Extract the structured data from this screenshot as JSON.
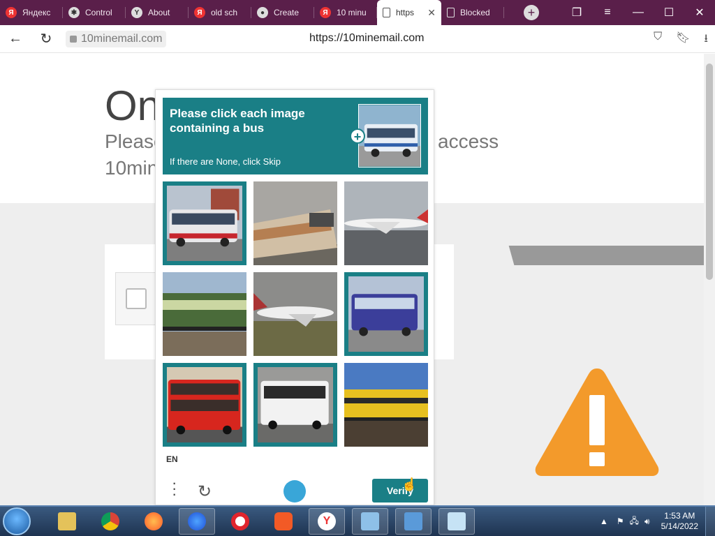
{
  "tabs": [
    {
      "label": "Яндекс",
      "icon": "yandex-icon"
    },
    {
      "label": "Control",
      "icon": "spider-icon"
    },
    {
      "label": "About",
      "icon": "yandex-browser-icon"
    },
    {
      "label": "old sch",
      "icon": "yandex-icon"
    },
    {
      "label": "Create",
      "icon": "github-icon"
    },
    {
      "label": "10 minu",
      "icon": "yandex-icon"
    },
    {
      "label": "https",
      "icon": "document-icon",
      "active": true
    },
    {
      "label": "Blocked",
      "icon": "document-icon"
    }
  ],
  "address": {
    "domain": "10minemail.com",
    "url": "https://10minemail.com"
  },
  "page": {
    "title_partial": "On",
    "sub_left": "Please",
    "sub_right": "access",
    "sub_line2": "10min"
  },
  "captcha": {
    "prompt": "Please click each image containing a bus",
    "hint": "If there are None, click Skip",
    "language": "EN",
    "verify_label": "Verify",
    "tiles": [
      {
        "subject": "bus",
        "selected": true
      },
      {
        "subject": "train",
        "selected": false
      },
      {
        "subject": "airplane",
        "selected": false
      },
      {
        "subject": "train",
        "selected": false
      },
      {
        "subject": "airplane",
        "selected": false
      },
      {
        "subject": "bus",
        "selected": true
      },
      {
        "subject": "bus",
        "selected": true
      },
      {
        "subject": "bus",
        "selected": true
      },
      {
        "subject": "train",
        "selected": false
      }
    ]
  },
  "taskbar": {
    "time": "1:53 AM",
    "date": "5/14/2022"
  },
  "colors": {
    "accent": "#1a7f86",
    "tabbar": "#5a1f4a",
    "warning": "#f39a2b"
  }
}
